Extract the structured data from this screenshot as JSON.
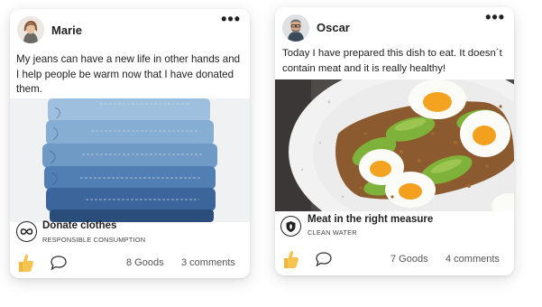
{
  "posts": [
    {
      "author": "Marie",
      "more_icon": "more-horizontal-icon",
      "text": "My jeans can have a new life in other hands and I help people be warm now that I have donated them.",
      "category": {
        "icon": "infinity-icon",
        "title": "Donate clothes",
        "subtitle": "RESPONSIBLE CONSUMPTION"
      },
      "like_icon": "thumbs-up-icon",
      "comment_icon": "speech-bubble-icon",
      "goods": "8 Goods",
      "comments": "3 comments"
    },
    {
      "author": "Oscar",
      "more_icon": "more-horizontal-icon",
      "text": "Today I have prepared this dish to eat. It doesn´t contain meat and it is really healthy!",
      "category": {
        "icon": "shield-leaf-icon",
        "title": "Meat in the right measure",
        "subtitle": "CLEAN WATER"
      },
      "like_icon": "thumbs-up-icon",
      "comment_icon": "speech-bubble-icon",
      "goods": "7 Goods",
      "comments": "4 comments"
    }
  ],
  "colors": {
    "like_yellow": "#f2b63c",
    "text_dark": "#222222",
    "text_muted": "#555555",
    "denim_dark": "#2e4f7f",
    "denim_light": "#8fb3d6"
  }
}
